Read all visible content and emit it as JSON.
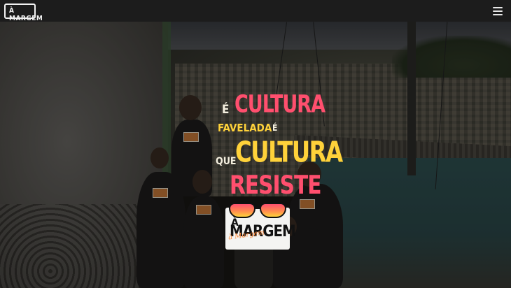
{
  "header": {
    "logo_text": "À MARGEM",
    "menu_icon": "hamburger-menu-icon"
  },
  "hero": {
    "line1_prefix": "É",
    "line1_word": "CULTURA",
    "line2_word": "FAVELADA",
    "line2_suffix": "É",
    "line3_prefix": "QUE",
    "line3_word": "CULTURA",
    "line4_word": "RESISTE",
    "brand_a": "À",
    "brand_word": "MARGEM",
    "brand_script": "à Margem"
  },
  "colors": {
    "navbar": "#1c1c1c",
    "accent_pink": "#ff4f6e",
    "accent_yellow": "#ffd23a",
    "text_light": "#f5f0e0"
  }
}
